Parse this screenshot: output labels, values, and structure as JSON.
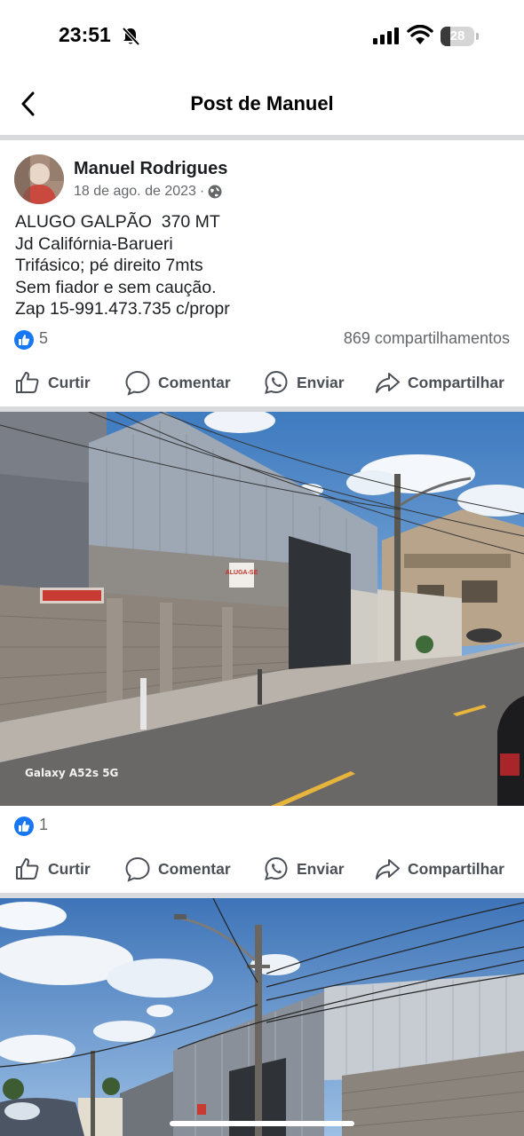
{
  "status_bar": {
    "time": "23:51",
    "battery": "28",
    "battery_level": 0.28
  },
  "header": {
    "title": "Post de Manuel"
  },
  "post": {
    "author": "Manuel Rodrigues",
    "date": "18 de ago. de 2023",
    "separator": "·",
    "text_lines": [
      "ALUGO GALPÃO  370 MT",
      "Jd Califórnia-Barueri",
      "Trifásico; pé direito 7mts",
      "Sem fiador e sem caução.",
      "Zap 15-991.473.735 c/propr"
    ],
    "reactions": "5",
    "shares": "869 compartilhamentos"
  },
  "actions": {
    "like": "Curtir",
    "comment": "Comentar",
    "send": "Enviar",
    "share": "Compartilhar"
  },
  "photos": [
    {
      "watermark": "Galaxy A52s 5G",
      "sign_1": "ALUGA-SE",
      "sign_2": "ALUGA-SE",
      "reactions": "1"
    },
    {}
  ],
  "icons": {
    "back": "chevron-left-icon",
    "muted": "bell-slash-icon",
    "signal": "cellular-signal-icon",
    "wifi": "wifi-icon",
    "privacy": "globe-icon",
    "like": "thumbs-up-icon",
    "comment": "speech-bubble-icon",
    "send": "whatsapp-icon",
    "share": "share-arrow-icon"
  },
  "colors": {
    "accent": "#1877f2",
    "text": "#1c1e21",
    "secondary": "#65676b",
    "divider": "#d9dadd"
  }
}
